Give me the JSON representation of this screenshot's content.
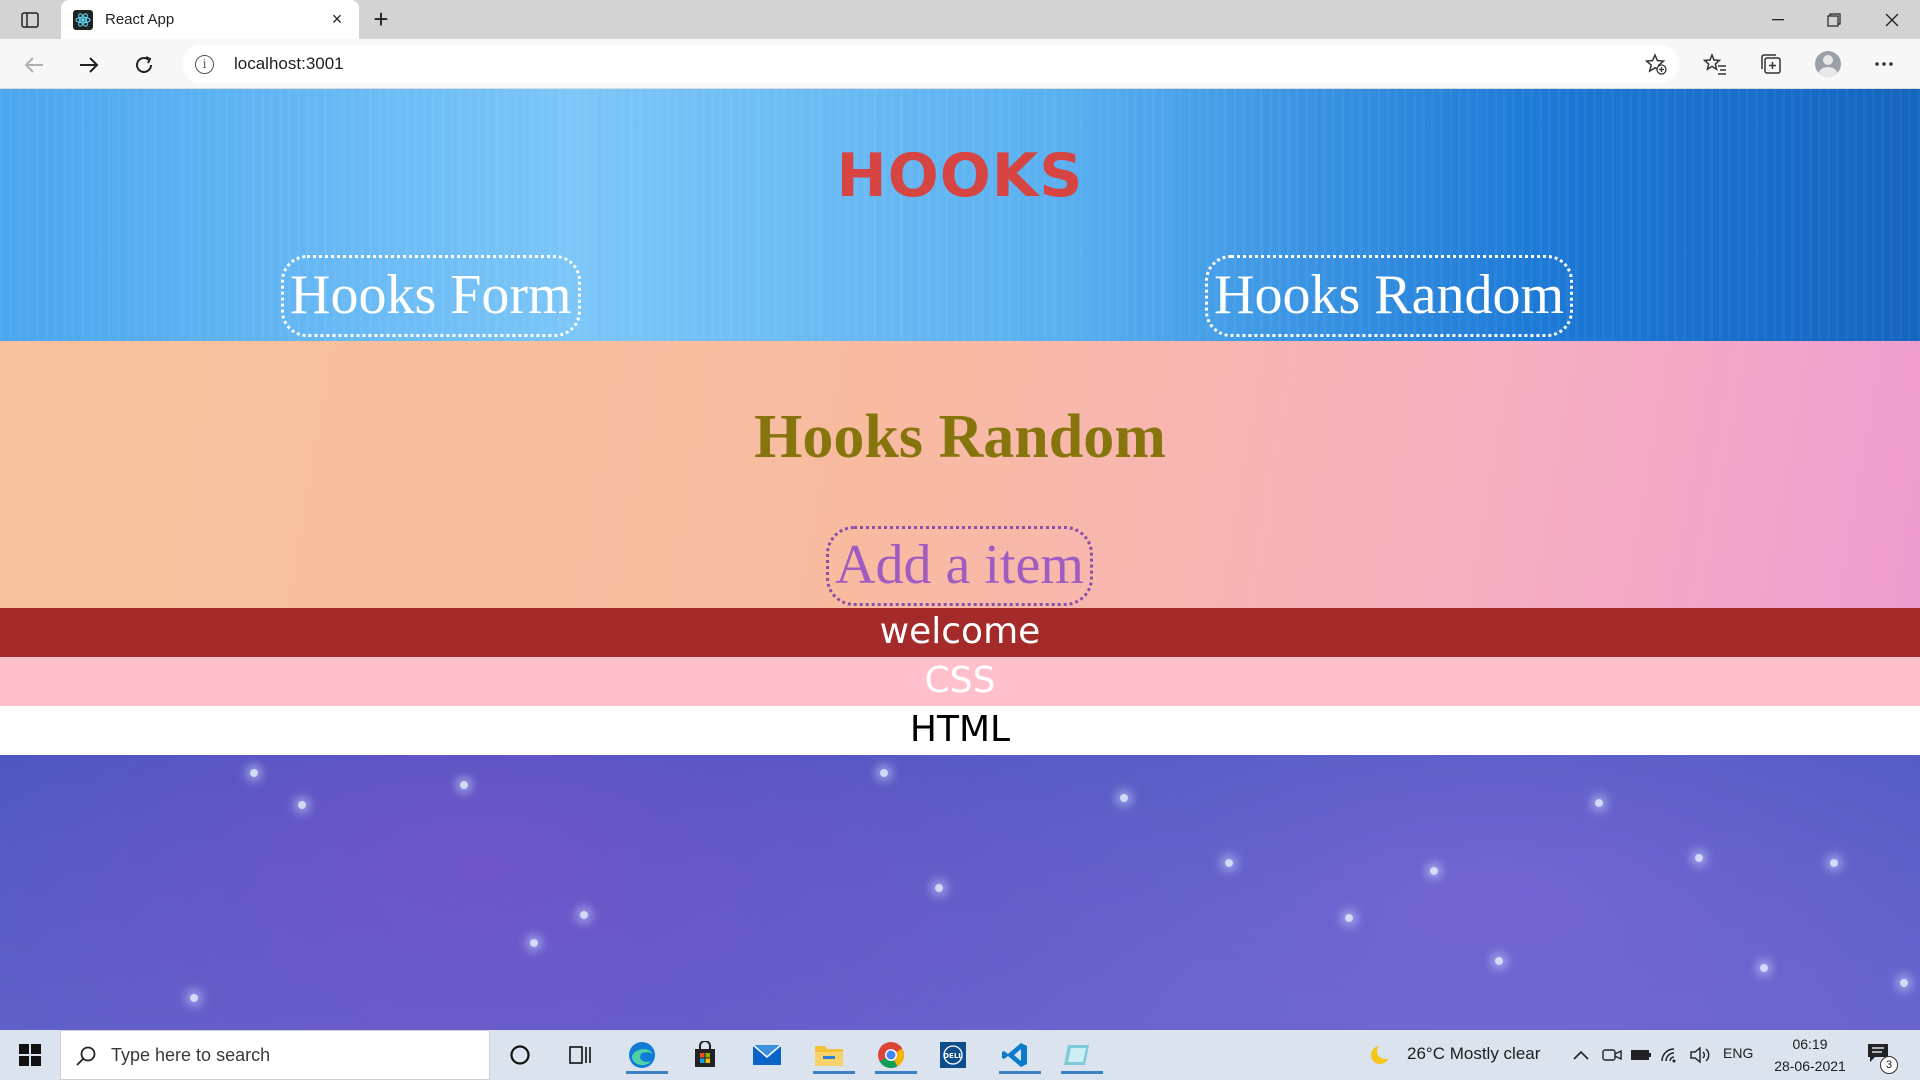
{
  "browser": {
    "tab_title": "React App",
    "url": "localhost:3001",
    "tab_close": "×",
    "new_tab": "+"
  },
  "app": {
    "title": "HOOKS",
    "nav": {
      "form_link": "Hooks Form",
      "random_link": "Hooks Random"
    },
    "section_title": "Hooks Random",
    "add_button": "Add a item",
    "items": [
      {
        "label": "welcome",
        "bg": "#a52a2a",
        "color": "#ffffff"
      },
      {
        "label": "CSS",
        "bg": "#ffc0cb",
        "color": "#ffffff"
      },
      {
        "label": "HTML",
        "bg": "#ffffff",
        "color": "#000000"
      }
    ],
    "colors": {
      "title": "#d64541",
      "section_title": "#86750d",
      "add_button": "#a05cc0"
    }
  },
  "taskbar": {
    "search_placeholder": "Type here to search",
    "weather": "26°C  Mostly clear",
    "language": "ENG",
    "time": "06:19",
    "date": "28-06-2021",
    "notification_count": "3"
  }
}
